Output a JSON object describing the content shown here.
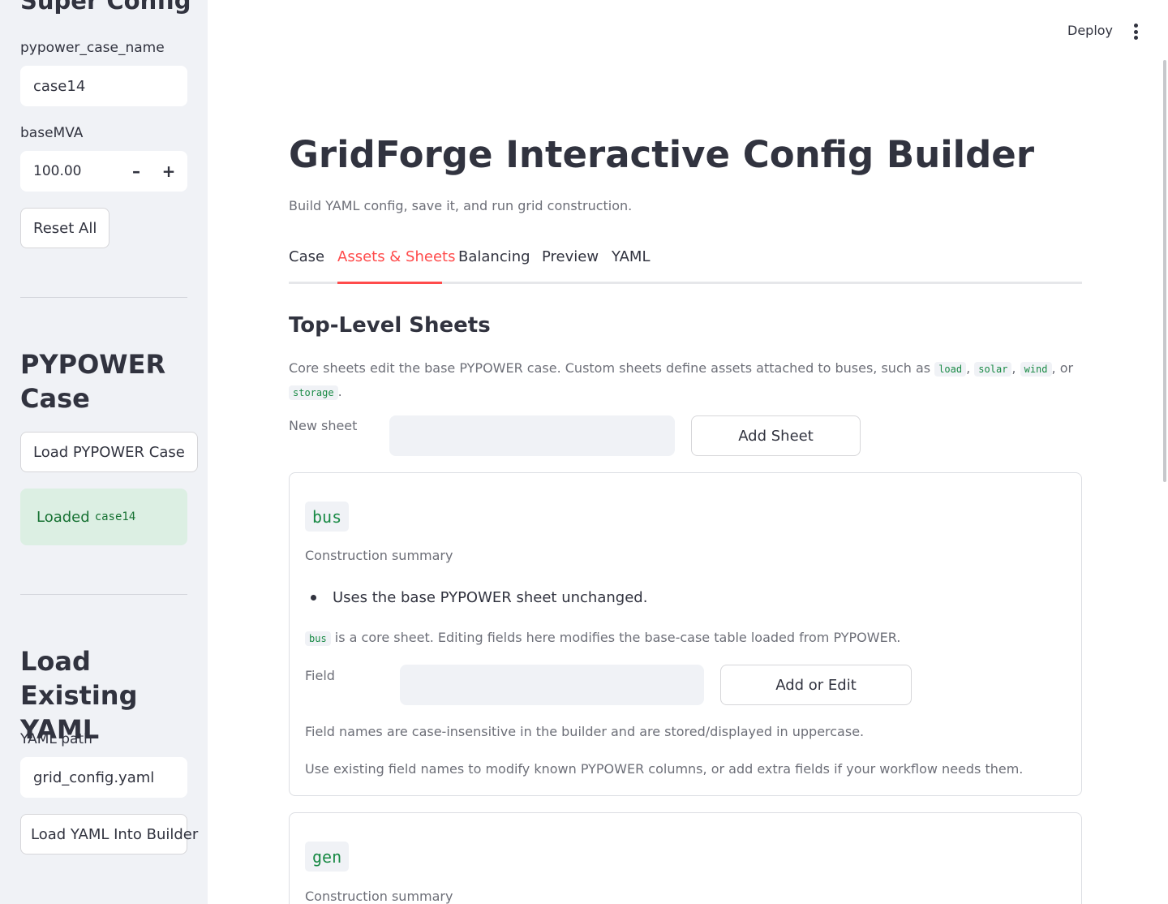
{
  "sidebar": {
    "title": "Super Config",
    "case_name_label": "pypower_case_name",
    "case_name_value": "case14",
    "basemva_label": "baseMVA",
    "basemva_value": "100.00",
    "minus_label": "–",
    "plus_label": "+",
    "reset_button": "Reset All",
    "pypower_heading": "PYPOWER Case",
    "load_case_button": "Load PYPOWER Case",
    "loaded_text": "Loaded",
    "loaded_case": "case14",
    "yaml_heading": "Load Existing YAML",
    "yaml_path_label": "YAML path",
    "yaml_path_value": "grid_config.yaml",
    "load_yaml_button": "Load YAML Into Builder"
  },
  "header": {
    "deploy_label": "Deploy",
    "menu_icon": "vertical-dots-icon"
  },
  "main": {
    "title": "GridForge Interactive Config Builder",
    "subtitle": "Build YAML config, save it, and run grid construction.",
    "tabs": [
      {
        "label": "Case",
        "active": false
      },
      {
        "label": "Assets & Sheets",
        "active": true
      },
      {
        "label": "Balancing",
        "active": false
      },
      {
        "label": "Preview",
        "active": false
      },
      {
        "label": "YAML",
        "active": false
      }
    ],
    "section_title": "Top-Level Sheets",
    "description": {
      "part1": "Core sheets edit the base PYPOWER case. Custom sheets define assets attached to buses, such as",
      "code1": "load",
      "sep1": ",",
      "code2": "solar",
      "sep2": ",",
      "code3": "wind",
      "sep3": ", or",
      "code4": "storage",
      "end": "."
    },
    "new_sheet_label": "New sheet",
    "new_sheet_value": "",
    "add_sheet_button": "Add Sheet"
  },
  "sheets": [
    {
      "name": "bus",
      "caption": "Construction summary",
      "bullet": "Uses the base PYPOWER sheet unchanged.",
      "core_note_code": "bus",
      "core_note": "is a core sheet. Editing fields here modifies the base-case table loaded from PYPOWER.",
      "field_label": "Field",
      "field_value": "",
      "add_edit_button": "Add or Edit",
      "note1": "Field names are case-insensitive in the builder and are stored/displayed in uppercase.",
      "note2": "Use existing field names to modify known PYPOWER columns, or add extra fields if your workflow needs them."
    },
    {
      "name": "gen",
      "caption": "Construction summary"
    }
  ],
  "colors": {
    "accent": "#ff4b4b",
    "sidebar_bg": "#f0f2f6",
    "success_bg": "#dcefe3",
    "success_text": "#177233",
    "code_text": "#198a45"
  }
}
